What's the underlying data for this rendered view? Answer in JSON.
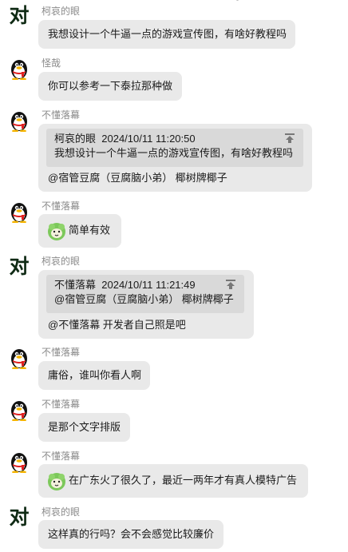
{
  "colors": {
    "bubble": "#e9e9e9",
    "quote": "#d9d9d9",
    "name": "#8a8a8a"
  },
  "messages": [
    {
      "sender": "柯哀的眼",
      "avatar": "对",
      "text": "我想设计一个牛逼一点的游戏宣传图，有啥好教程吗"
    },
    {
      "sender": "怪哉",
      "avatar": "penguin-avatar",
      "text": "你可以参考一下泰拉那种做"
    },
    {
      "sender": "不懂落幕",
      "avatar": "penguin-avatar",
      "quote": {
        "author": "柯哀的眼",
        "time": "2024/10/11 11:20:50",
        "text": "我想设计一个牛逼一点的游戏宣传图，有啥好教程吗"
      },
      "text": "@宿管豆腐（豆腐脑小弟） 椰树牌椰子"
    },
    {
      "sender": "不懂落幕",
      "avatar": "penguin-avatar",
      "sticker": "cabbage-sticker",
      "text": "简单有效"
    },
    {
      "sender": "柯哀的眼",
      "avatar": "对",
      "quote": {
        "author": "不懂落幕",
        "time": "2024/10/11 11:21:49",
        "text": "@宿管豆腐（豆腐脑小弟） 椰树牌椰子"
      },
      "text": "@不懂落幕 开发者自己照是吧"
    },
    {
      "sender": "不懂落幕",
      "avatar": "penguin-avatar",
      "text": "庸俗，谁叫你看人啊"
    },
    {
      "sender": "不懂落幕",
      "avatar": "penguin-avatar",
      "text": "是那个文字排版"
    },
    {
      "sender": "不懂落幕",
      "avatar": "penguin-avatar",
      "sticker": "cabbage-sticker",
      "text": "在广东火了很久了，最近一两年才有真人模特广告"
    },
    {
      "sender": "柯哀的眼",
      "avatar": "对",
      "text": "这样真的行吗？会不会感觉比较廉价"
    }
  ]
}
